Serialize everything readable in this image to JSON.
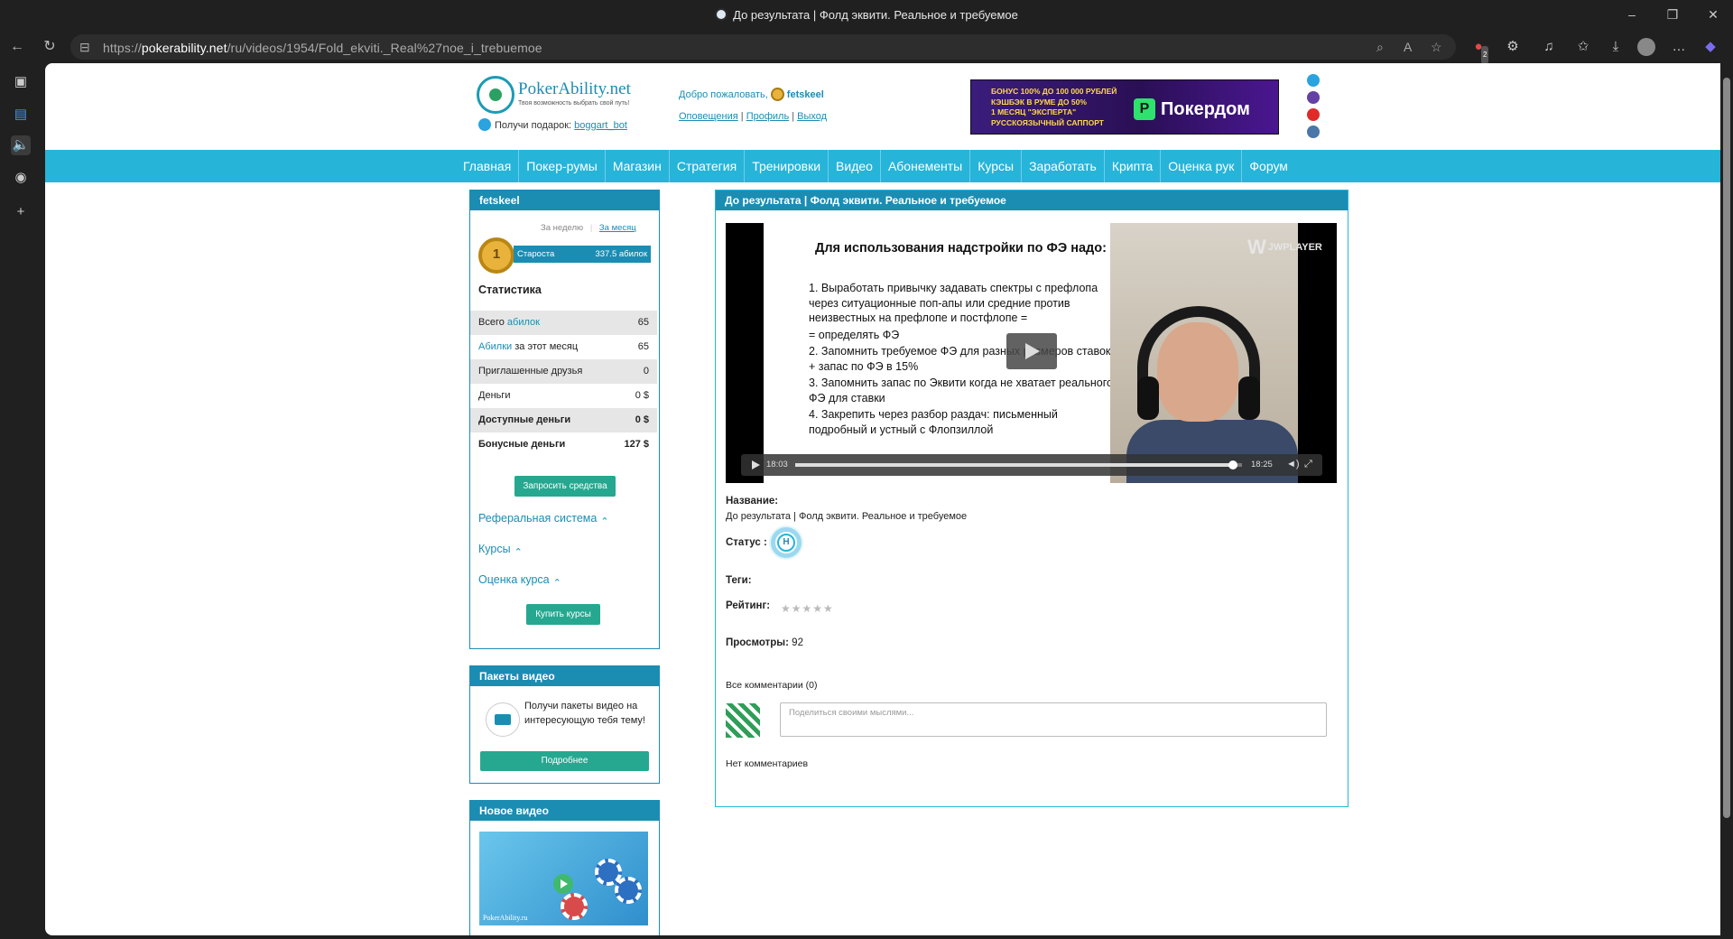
{
  "browser": {
    "title": "До результата | Фолд эквити. Реальное и требуемое",
    "url_prefix": "https://",
    "url_domain": "pokerability.net",
    "url_path": "/ru/videos/1954/Fold_ekviti._Real%27noe_i_trebuemoe",
    "icons": [
      "back-icon",
      "reload-icon",
      "zoom-icon",
      "read-aloud-icon",
      "favorite-icon",
      "adblock-icon",
      "extensions-icon",
      "music-icon",
      "favorites-icon",
      "download-icon",
      "profile-icon",
      "more-icon",
      "copilot-icon"
    ],
    "adblock_count": "2"
  },
  "site": {
    "logo_name": "PokerAbility.net",
    "logo_tagline": "Твоя возможность выбрать свой путь!",
    "gift_label": "Получи подарок:",
    "gift_link": "boggart_bot",
    "welcome": "Добро пожаловать,",
    "username": "fetskeel",
    "link_notifications": "Оповещения",
    "link_profile": "Профиль",
    "link_logout": "Выход",
    "sep": "|",
    "banner_lines": [
      "БОНУС 100% ДО 100 000 РУБЛЕЙ",
      "КЭШБЭК В РУМЕ ДО 50%",
      "1 МЕСЯЦ \"ЭКСПЕРТА\"",
      "РУССКОЯЗЫЧНЫЙ САППОРТ"
    ],
    "banner_brand": "Покердом",
    "accent_color": "#27b4d9",
    "primary_color": "#1b8db3",
    "button_color": "#26a890"
  },
  "menu": [
    "Главная",
    "Покер-румы",
    "Магазин",
    "Стратегия",
    "Тренировки",
    "Видео",
    "Абонементы",
    "Курсы",
    "Заработать",
    "Крипта",
    "Оценка рук",
    "Форум"
  ],
  "user_panel": {
    "title": "fetskeel",
    "period_week": "За неделю",
    "period_month": "За месяц",
    "rank_number": "1",
    "rank_label": "Староста",
    "rank_points": "337.5 абилок",
    "stats_title": "Статистика",
    "stats": [
      {
        "label": "Всего ",
        "link": "абилок",
        "value": "65"
      },
      {
        "label": " за этот месяц",
        "link": "Абилки",
        "value": "65"
      },
      {
        "label": "Приглашенные друзья",
        "value": "0"
      },
      {
        "label": "Деньги",
        "value": "0 $"
      },
      {
        "label": "Доступные деньги",
        "value": "0 $"
      },
      {
        "label": "Бонусные деньги",
        "value": "127 $"
      }
    ],
    "request_button": "Запросить средства",
    "referral": "Реферальная система",
    "courses": "Курсы",
    "course_rating": "Оценка курса",
    "buy_courses": "Купить курсы"
  },
  "packages_panel": {
    "title": "Пакеты видео",
    "text": "Получи пакеты видео на интересующую тебя тему!",
    "button": "Подробнее"
  },
  "new_video_panel": {
    "title": "Новое видео",
    "thumb_logo": "PokerAbility.ru"
  },
  "video": {
    "header": "До результата | Фолд эквити. Реальное и требуемое",
    "slide_title": "Для использования надстройки по ФЭ надо:",
    "slide_points": [
      "1. Выработать привычку задавать спектры с префлопа через ситуационные поп-апы или средние против неизвестных на префлопе и постфлопе =",
      " = определять ФЭ",
      "2. Запомнить требуемое ФЭ для разных размеров ставок + запас по ФЭ в 15%",
      "3. Запомнить запас по Эквити когда не хватает реального ФЭ для ставки",
      "4. Закрепить через разбор раздач: письменный подробный и устный с Флопзиллой"
    ],
    "player_brand": "JWPLAYER",
    "time_current": "18:03",
    "time_total": "18:25",
    "progress": 0.98,
    "name_label": "Название:",
    "name_value": "До результата | Фолд эквити. Реальное и требуемое",
    "status_label": "Статус :",
    "status_value": "Н",
    "tags_label": "Теги:",
    "rating_label": "Рейтинг:",
    "rating_stars": "★★★★★",
    "rating_value": 0,
    "views_label": "Просмотры:",
    "views_value": "92",
    "comments_label": "Все комментарии (0)",
    "comment_placeholder": "Поделиться своими мыслями...",
    "no_comments": "Нет комментариев"
  }
}
